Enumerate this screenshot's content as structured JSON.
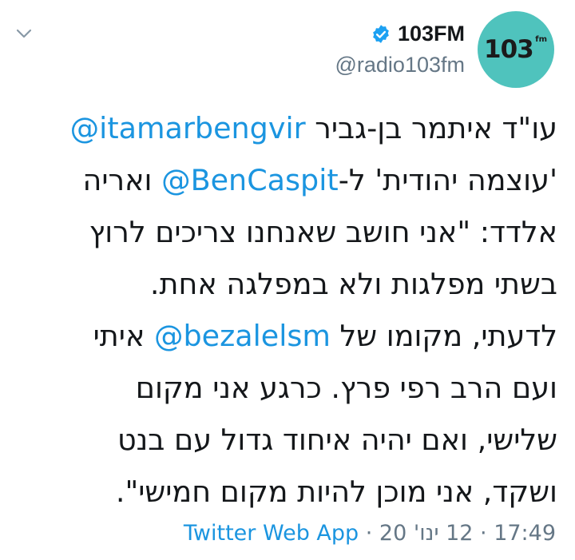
{
  "header": {
    "display_name": "103FM",
    "handle": "@radio103fm",
    "avatar_label": "103",
    "avatar_suffix": "fm"
  },
  "colors": {
    "link": "#1b95e0",
    "text": "#14171a",
    "muted": "#657786",
    "avatar_bg": "#4fc3bd",
    "verified": "#1da1f2"
  },
  "icons": {
    "menu": "chevron-down-icon",
    "verified": "verified-badge-icon"
  },
  "tweet": {
    "lines": [
      [
        {
          "t": "עו\"ד איתמר בן-גביר "
        },
        {
          "t": "@itamarbengvir",
          "m": true
        }
      ],
      [
        {
          "t": "'עוצמה יהודית' ל-"
        },
        {
          "t": "@BenCaspit",
          "m": true
        },
        {
          "t": " ואריה"
        }
      ],
      [
        {
          "t": "אלדד: \"אני חושב שאנחנו צריכים לרוץ"
        }
      ],
      [
        {
          "t": "בשתי מפלגות ולא במפלגה אחת."
        }
      ],
      [
        {
          "t": "לדעתי, מקומו של "
        },
        {
          "t": "@bezalelsm",
          "m": true
        },
        {
          "t": " איתי"
        }
      ],
      [
        {
          "t": "ועם הרב רפי פרץ. כרגע אני מקום"
        }
      ],
      [
        {
          "t": "שלישי, ואם יהיה איחוד גדול עם בנט"
        }
      ],
      [
        {
          "t": "ושקד, אני מוכן להיות מקום חמישי\"."
        }
      ]
    ]
  },
  "meta": {
    "time": "17:49",
    "sep1": " · ",
    "date": "12 ינו' 20",
    "sep2": " · ",
    "source": "Twitter Web App"
  }
}
